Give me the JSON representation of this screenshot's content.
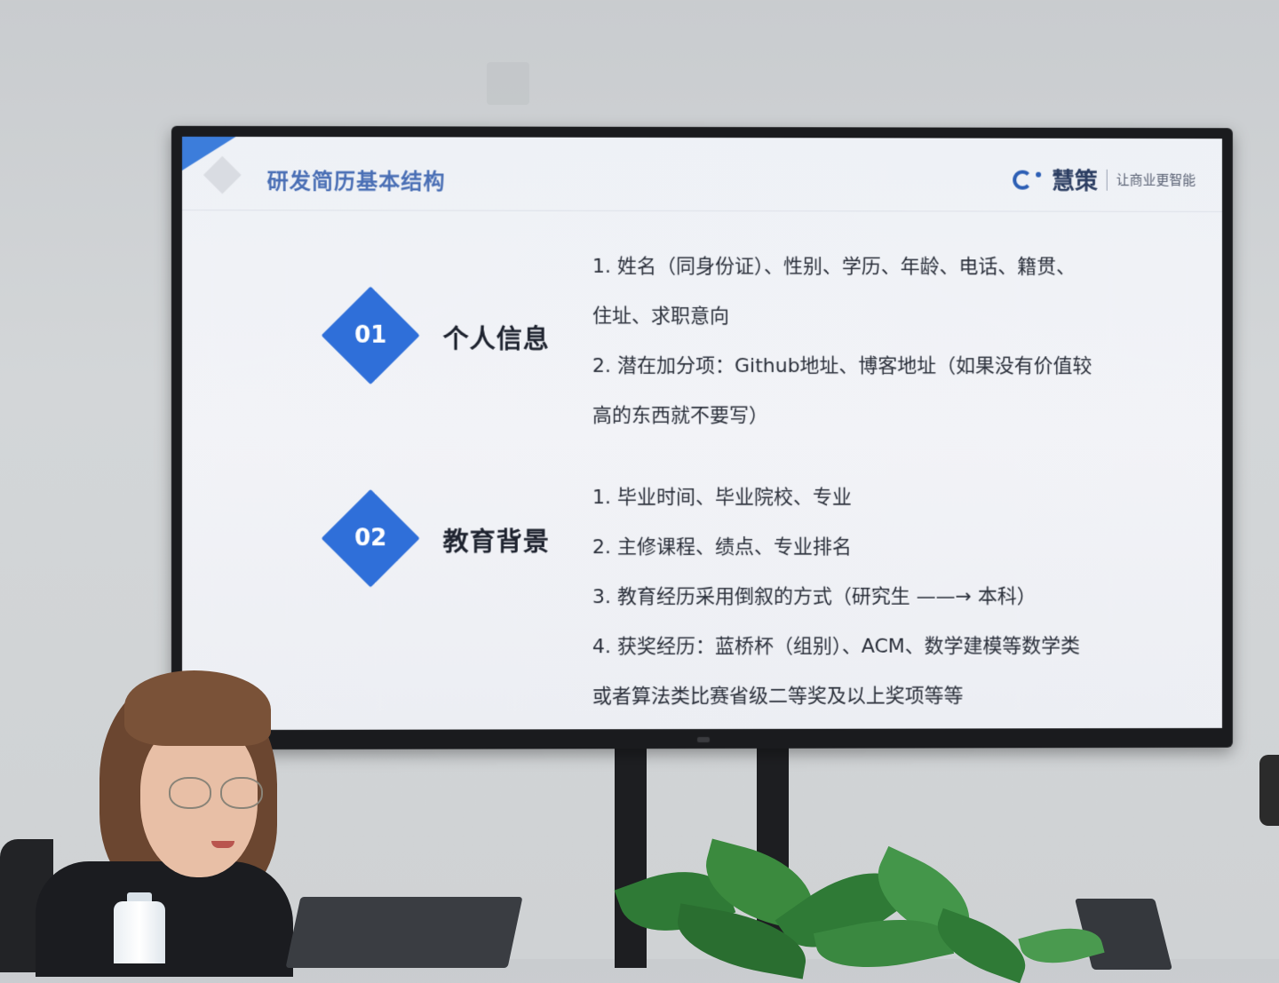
{
  "slide": {
    "title": "研发简历基本结构",
    "brand_name": "慧策",
    "brand_slogan": "让商业更智能"
  },
  "sections": [
    {
      "number": "01",
      "title": "个人信息",
      "items": [
        "1. 姓名（同身份证）、性别、学历、年龄、电话、籍贯、",
        "住址、求职意向",
        "2. 潜在加分项：Github地址、博客地址（如果没有价值较",
        "高的东西就不要写）"
      ]
    },
    {
      "number": "02",
      "title": "教育背景",
      "items": [
        "1. 毕业时间、毕业院校、专业",
        "2. 主修课程、绩点、专业排名",
        "3. 教育经历采用倒叙的方式（研究生 ——→ 本科）",
        "4. 获奖经历：蓝桥杯（组别）、ACM、数学建模等数学类",
        "或者算法类比赛省级二等奖及以上奖项等等"
      ]
    }
  ],
  "colors": {
    "accent_blue": "#2f6fd9",
    "title_blue": "#4a6fb5",
    "screen_bg": "#eef1f6",
    "bezel": "#1a1b1e"
  },
  "icons": {
    "brand_logo": "brand-logo-icon"
  }
}
